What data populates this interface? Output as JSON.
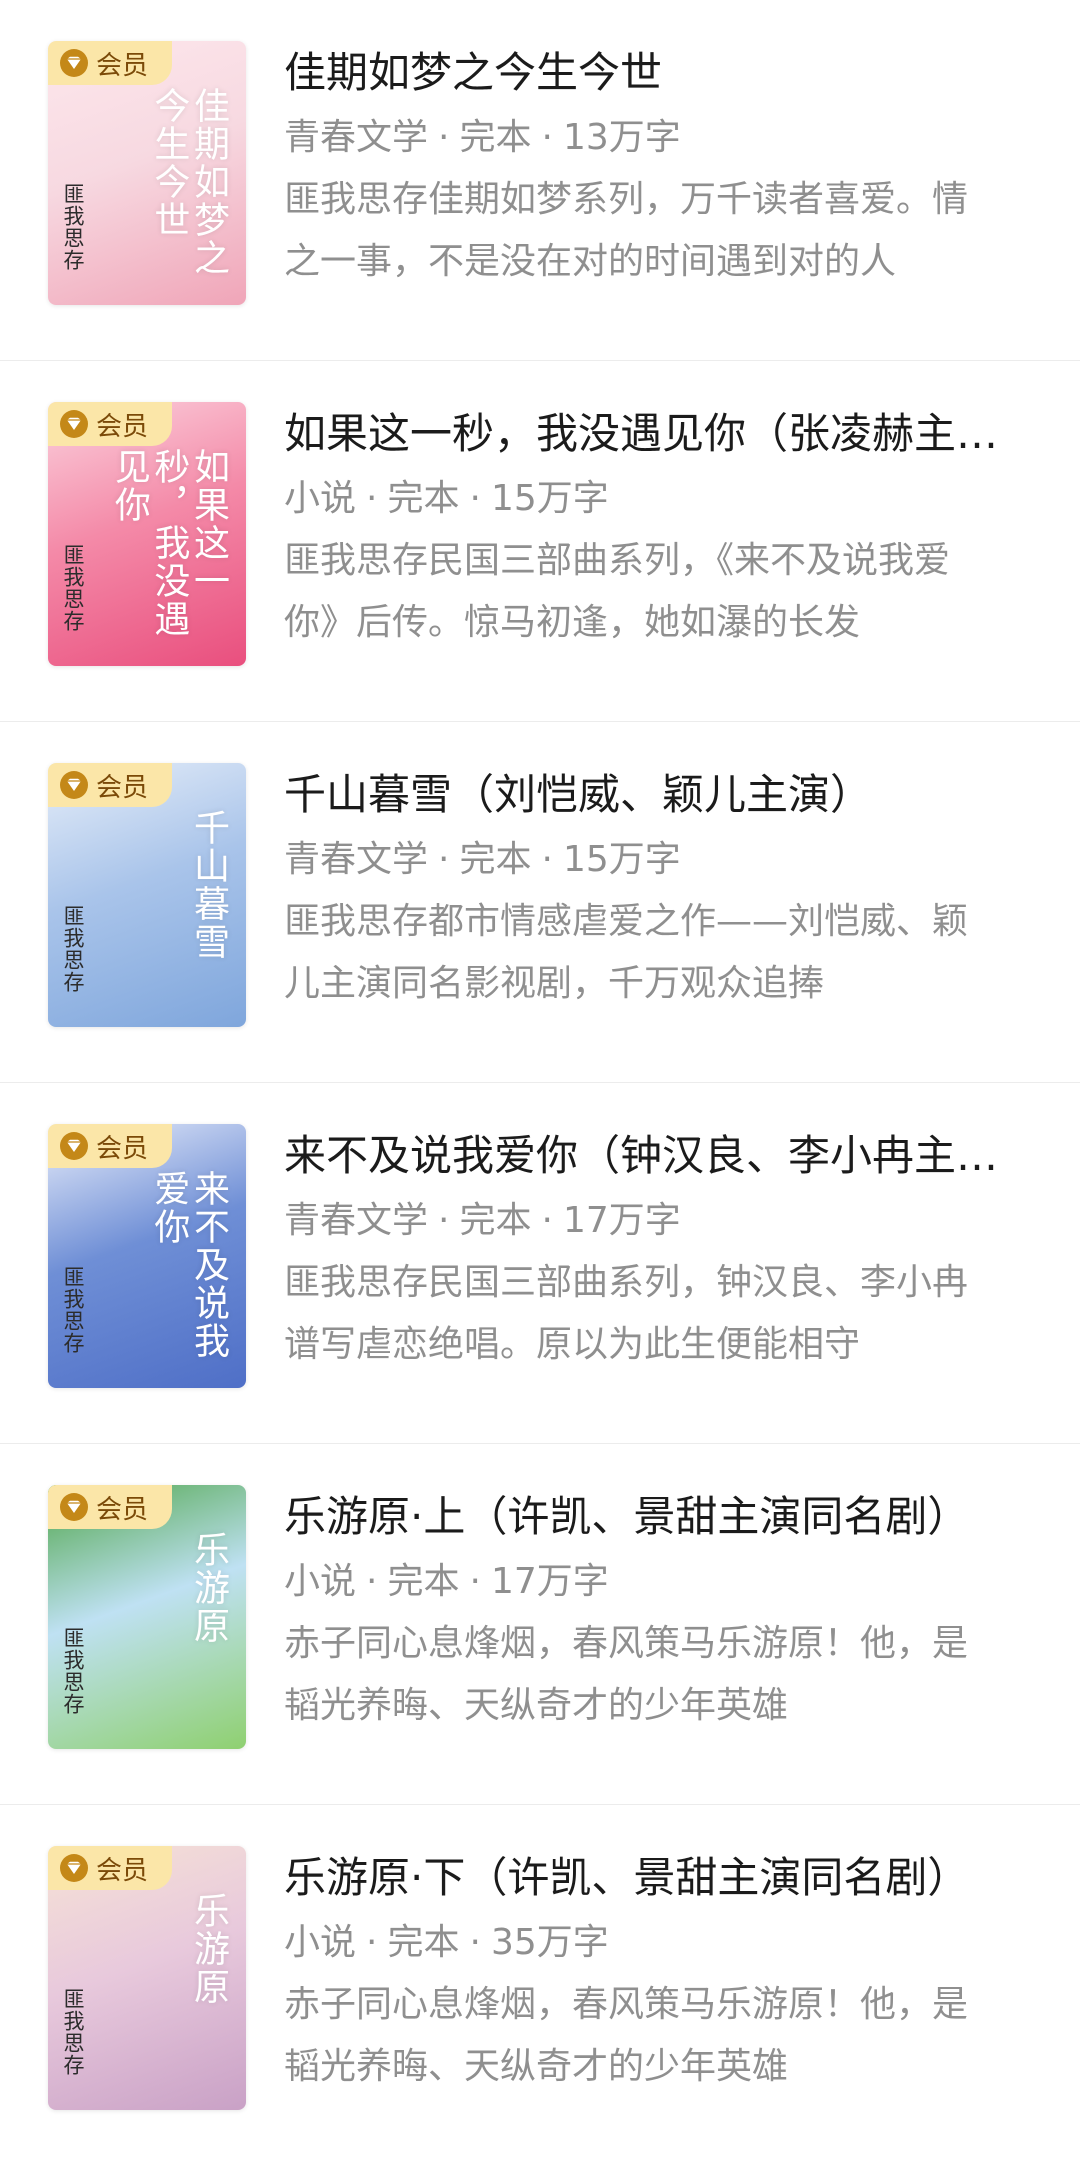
{
  "vip_label": "会员",
  "separator": "·",
  "books": [
    {
      "cover_title": "佳期如梦之今生今世",
      "cover_author": "匪我思存",
      "title": "佳期如梦之今生今世",
      "category": "青春文学",
      "status": "完本",
      "word_count": "13万字",
      "description": "匪我思存佳期如梦系列，万千读者喜爱。情之一事，不是没在对的时间遇到对的人",
      "colors": [
        "#f7d9e1",
        "#f0a5b8",
        "#fde7ec"
      ]
    },
    {
      "cover_title": "如果这一秒，我没遇见你",
      "cover_author": "匪我思存",
      "title": "如果这一秒，我没遇见你（张凌赫主演）",
      "category": "小说",
      "status": "完本",
      "word_count": "15万字",
      "description": "匪我思存民国三部曲系列，《来不及说我爱你》后传。惊马初逢，她如瀑的长发",
      "colors": [
        "#f48aa8",
        "#e94f7e",
        "#fbd2de"
      ]
    },
    {
      "cover_title": "千山暮雪",
      "cover_author": "匪我思存",
      "title": "千山暮雪（刘恺威、颖儿主演）",
      "category": "青春文学",
      "status": "完本",
      "word_count": "15万字",
      "description": "匪我思存都市情感虐爱之作——刘恺威、颖儿主演同名影视剧，千万观众追捧",
      "colors": [
        "#a9c4ea",
        "#7fa6dc",
        "#e6eef9"
      ]
    },
    {
      "cover_title": "来不及说我爱你",
      "cover_author": "匪我思存",
      "title": "来不及说我爱你（钟汉良、李小冉主演）",
      "category": "青春文学",
      "status": "完本",
      "word_count": "17万字",
      "description": "匪我思存民国三部曲系列，钟汉良、李小冉谱写虐恋绝唱。原以为此生便能相守",
      "colors": [
        "#6f8fd6",
        "#4f6fc7",
        "#e9eefb"
      ]
    },
    {
      "cover_title": "乐游原",
      "cover_author": "匪我思存",
      "title": "乐游原·上（许凯、景甜主演同名剧）",
      "category": "小说",
      "status": "完本",
      "word_count": "17万字",
      "description": "赤子同心息烽烟，春风策马乐游原！他，是韬光养晦、天纵奇才的少年英雄",
      "colors": [
        "#bfe1f3",
        "#8fd070",
        "#4fa64a"
      ]
    },
    {
      "cover_title": "乐游原",
      "cover_author": "匪我思存",
      "title": "乐游原·下（许凯、景甜主演同名剧）",
      "category": "小说",
      "status": "完本",
      "word_count": "35万字",
      "description": "赤子同心息烽烟，春风策马乐游原！他，是韬光养晦、天纵奇才的少年英雄",
      "colors": [
        "#e8c9dc",
        "#c9a1c6",
        "#f6e2d6"
      ]
    }
  ]
}
